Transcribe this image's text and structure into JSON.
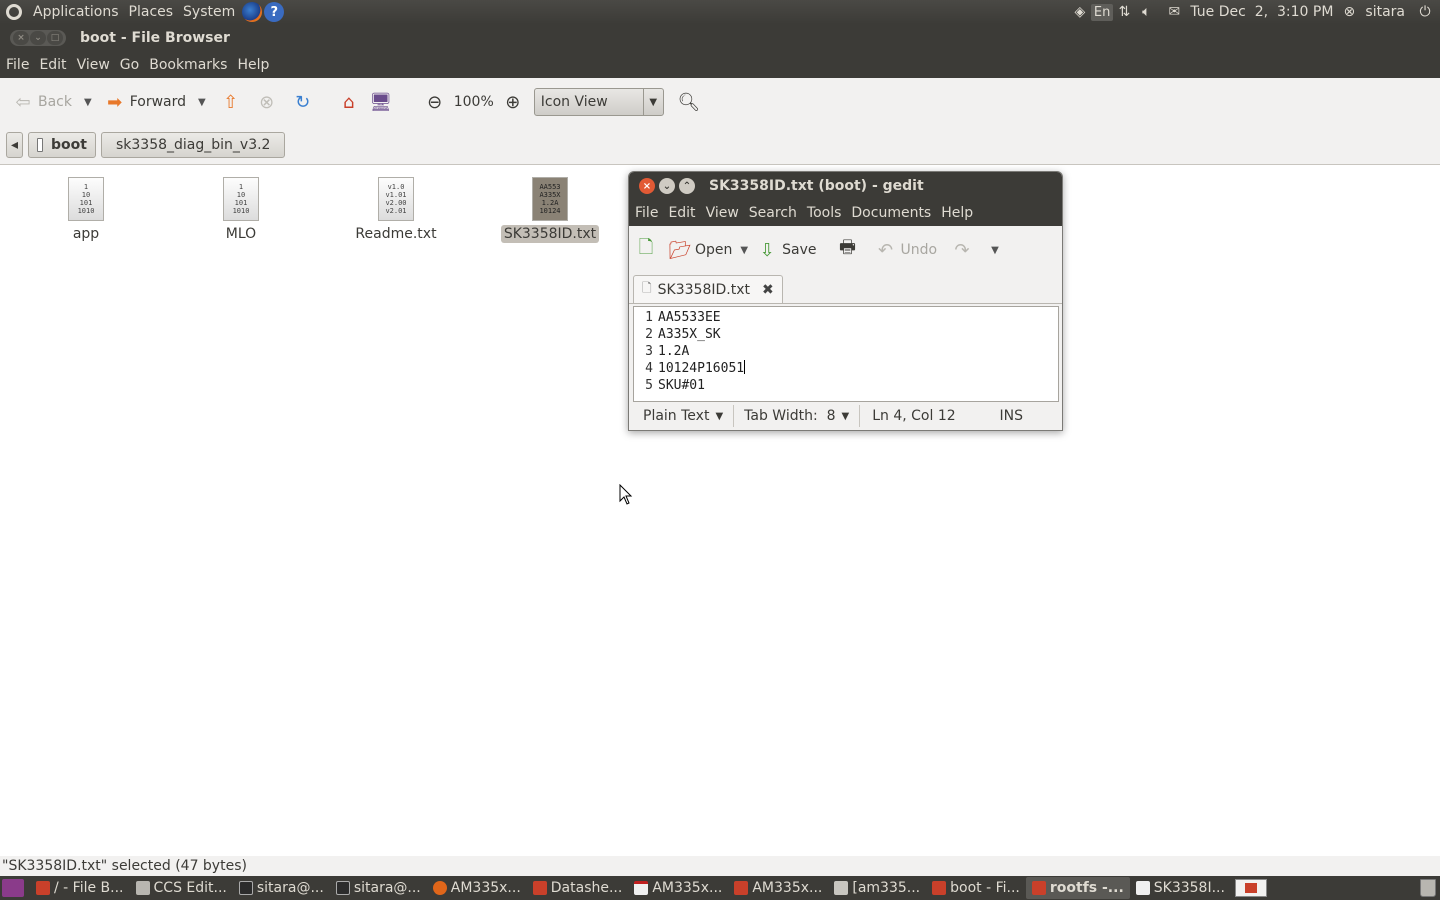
{
  "top_panel": {
    "menus": [
      "Applications",
      "Places",
      "System"
    ],
    "lang": "En",
    "clock": "Tue Dec  2,  3:10 PM",
    "user": "sitara"
  },
  "file_browser": {
    "title": "boot - File Browser",
    "menu": [
      "File",
      "Edit",
      "View",
      "Go",
      "Bookmarks",
      "Help"
    ],
    "toolbar": {
      "back": "Back",
      "forward": "Forward",
      "zoom": "100%",
      "view_mode": "Icon View"
    },
    "path": {
      "current": "boot",
      "child": "sk3358_diag_bin_v3.2"
    },
    "files": [
      {
        "name": "app",
        "preview": [
          "1",
          "10",
          "101",
          "1010"
        ],
        "selected": false
      },
      {
        "name": "MLO",
        "preview": [
          "1",
          "10",
          "101",
          "1010"
        ],
        "selected": false
      },
      {
        "name": "Readme.txt",
        "preview": [
          "v1.0",
          "v1.01",
          "v2.00",
          "v2.01"
        ],
        "selected": false
      },
      {
        "name": "SK3358ID.txt",
        "preview": [
          "AA553",
          "A335X",
          "1.2A",
          "10124"
        ],
        "selected": true
      }
    ],
    "status": "\"SK3358ID.txt\" selected (47 bytes)"
  },
  "gedit": {
    "title": "SK3358ID.txt (boot) - gedit",
    "menu": [
      "File",
      "Edit",
      "View",
      "Search",
      "Tools",
      "Documents",
      "Help"
    ],
    "toolbar": {
      "open": "Open",
      "save": "Save",
      "undo": "Undo"
    },
    "tab": "SK3358ID.txt",
    "lines": [
      "AA5533EE",
      "A335X_SK",
      "1.2A",
      "10124P16051",
      "SKU#01"
    ],
    "line_numbers": [
      "1",
      "2",
      "3",
      "4",
      "5"
    ],
    "status": {
      "syntax": "Plain Text",
      "tab_width": "Tab Width:  8",
      "position": "Ln 4, Col 12",
      "mode": "INS"
    }
  },
  "taskbar": [
    {
      "label": "/ - File B...",
      "active": false
    },
    {
      "label": "CCS Edit...",
      "active": false
    },
    {
      "label": "sitara@...",
      "active": false
    },
    {
      "label": "sitara@...",
      "active": false
    },
    {
      "label": "AM335x...",
      "active": false
    },
    {
      "label": "Datashe...",
      "active": false
    },
    {
      "label": "AM335x...",
      "active": false
    },
    {
      "label": "AM335x...",
      "active": false
    },
    {
      "label": "[am335...",
      "active": false
    },
    {
      "label": "boot - Fi...",
      "active": false
    },
    {
      "label": "rootfs -...",
      "active": true
    },
    {
      "label": "SK3358I...",
      "active": false
    }
  ]
}
